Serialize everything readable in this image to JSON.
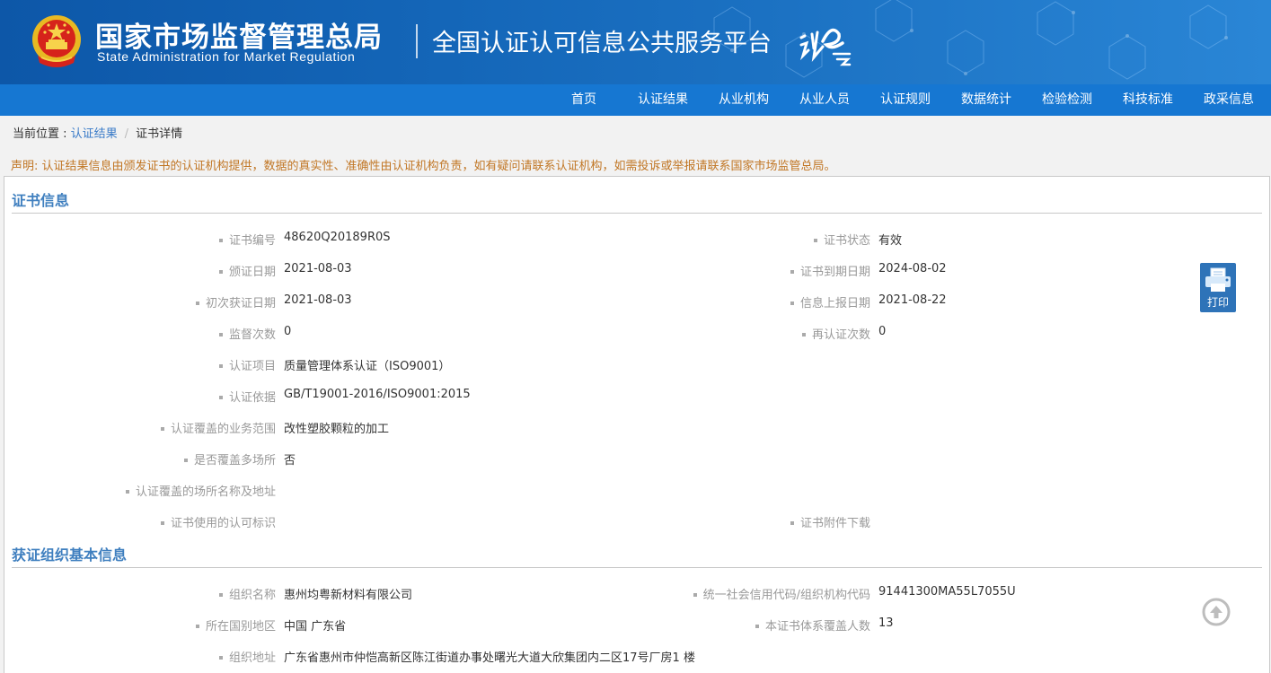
{
  "header": {
    "org_cn": "国家市场监督管理总局",
    "org_en": "State Administration  for  Market Regulation",
    "platform": "全国认证认可信息公共服务平台",
    "logo_text": "认e云"
  },
  "nav": [
    "首页",
    "认证结果",
    "从业机构",
    "从业人员",
    "认证规则",
    "数据统计",
    "检验检测",
    "科技标准",
    "政采信息"
  ],
  "breadcrumb": {
    "prefix": "当前位置 : ",
    "link": "认证结果",
    "sep": "/",
    "current": "证书详情"
  },
  "notice": "声明: 认证结果信息由颁发证书的认证机构提供，数据的真实性、准确性由认证机构负责，如有疑问请联系认证机构，如需投诉或举报请联系国家市场监管总局。",
  "cert_section": {
    "title": "证书信息",
    "left": [
      {
        "label": "证书编号",
        "value": "48620Q20189R0S"
      },
      {
        "label": "颁证日期",
        "value": "2021-08-03"
      },
      {
        "label": "初次获证日期",
        "value": "2021-08-03"
      },
      {
        "label": "监督次数",
        "value": "0"
      },
      {
        "label": "认证项目",
        "value": "质量管理体系认证（ISO9001）"
      },
      {
        "label": "认证依据",
        "value": "GB/T19001-2016/ISO9001:2015"
      },
      {
        "label": "认证覆盖的业务范围",
        "value": "改性塑胶颗粒的加工"
      },
      {
        "label": "是否覆盖多场所",
        "value": "否"
      },
      {
        "label": "认证覆盖的场所名称及地址",
        "value": ""
      },
      {
        "label": "证书使用的认可标识",
        "value": ""
      }
    ],
    "right": [
      {
        "label": "证书状态",
        "value": "有效"
      },
      {
        "label": "证书到期日期",
        "value": "2024-08-02"
      },
      {
        "label": "信息上报日期",
        "value": "2021-08-22"
      },
      {
        "label": "再认证次数",
        "value": "0"
      },
      {
        "label": "证书附件下载",
        "value": ""
      }
    ]
  },
  "org_section": {
    "title": "获证组织基本信息",
    "left": [
      {
        "label": "组织名称",
        "value": "惠州均粤新材料有限公司"
      },
      {
        "label": "所在国别地区",
        "value": "中国 广东省"
      },
      {
        "label": "组织地址",
        "value": "广东省惠州市仲恺高新区陈江街道办事处曙光大道大欣集团内二区17号厂房1 楼"
      }
    ],
    "right": [
      {
        "label": "统一社会信用代码/组织机构代码",
        "value": "91441300MA55L7055U"
      },
      {
        "label": "本证书体系覆盖人数",
        "value": "13"
      }
    ]
  },
  "print_label": "打印",
  "colors": {
    "header": "#1466b8",
    "nav": "#1677d2",
    "title": "#3f7fbf",
    "notice": "#c17624",
    "print": "#2e73b8"
  }
}
